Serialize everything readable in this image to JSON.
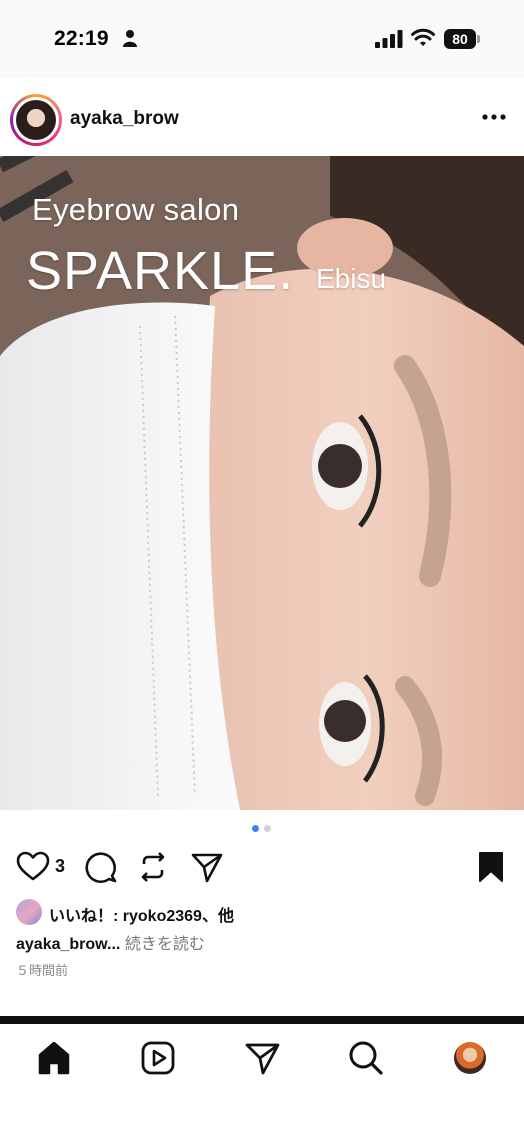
{
  "status_bar": {
    "time": "22:19",
    "battery": "80",
    "icons": [
      "person-icon",
      "signal-icon",
      "wifi-icon",
      "battery-icon"
    ]
  },
  "post": {
    "username": "ayaka_brow",
    "more_icon": "ellipsis-icon",
    "image_text": {
      "line1": "Eyebrow salon",
      "brand": "SPARKLE.",
      "location": "Ebisu"
    },
    "carousel": {
      "current": 1,
      "total": 2
    },
    "like_count": "3",
    "likes_line": "いいね！: ryoko2369、他",
    "caption_user": "ayaka_brow...",
    "caption_more": "続きを読む",
    "timestamp": "５時間前",
    "bookmarked": true
  },
  "bottom_nav": {
    "items": [
      "home-icon",
      "reels-icon",
      "direct-icon",
      "search-icon",
      "profile-avatar"
    ],
    "active": "home-icon"
  },
  "colors": {
    "accent_dot": "#3b82f6",
    "text_primary": "#111111",
    "text_secondary": "#7a7a7a"
  }
}
